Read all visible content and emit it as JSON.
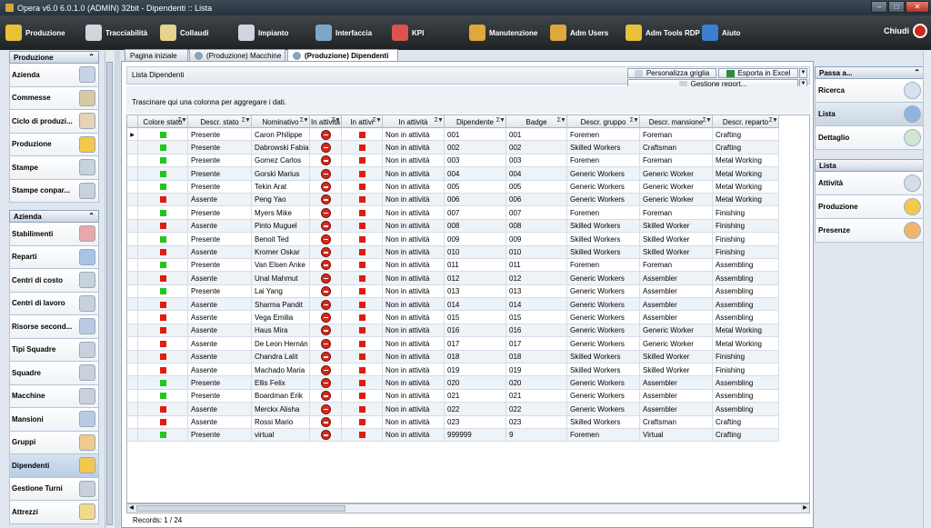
{
  "window": {
    "title": "Opera v6.0 6.0.1.0 (ADMIN) 32bit - Dipendenti :: Lista"
  },
  "menu": {
    "items": [
      {
        "label": "Produzione",
        "icon": "gear-icon",
        "color": "#e8c23a"
      },
      {
        "label": "Tracciabilità",
        "icon": "cable-icon",
        "color": "#cfd6dd"
      },
      {
        "label": "Collaudi",
        "icon": "clipboard-icon",
        "color": "#e7d28e"
      },
      {
        "label": "Impianto",
        "icon": "monitor-icon",
        "color": "#cfd6dd"
      },
      {
        "label": "Interfaccia",
        "icon": "plug-icon",
        "color": "#7fa6c9"
      },
      {
        "label": "KPI",
        "icon": "chart-icon",
        "color": "#d9534f"
      },
      {
        "label": "Manutenzione",
        "icon": "tools-icon",
        "color": "#e0a73a"
      },
      {
        "label": "Adm Users",
        "icon": "user-icon",
        "color": "#e0a73a"
      },
      {
        "label": "Adm Tools RDP",
        "icon": "wrench-icon",
        "color": "#e8c23a"
      },
      {
        "label": "Aiuto",
        "icon": "help-icon",
        "color": "#3a7fd0"
      }
    ],
    "close_label": "Chiudi"
  },
  "leftnav": {
    "produzione_title": "Produzione",
    "produzione_items": [
      "Azienda",
      "Commesse",
      "Ciclo di produzi...",
      "Produzione",
      "Stampe",
      "Stampe conpar..."
    ],
    "azienda_title": "Azienda",
    "azienda_items": [
      "Stabilimenti",
      "Reparti",
      "Centri di costo",
      "Centri di lavoro",
      "Risorse second...",
      "Tipi Squadre",
      "Squadre",
      "Macchine",
      "Mansioni",
      "Gruppi",
      "Dipendenti",
      "Gestione Turni",
      "Attrezzi"
    ],
    "selected": "Dipendenti"
  },
  "tabs": [
    "Pagina iniziale",
    "(Produzione) Macchine",
    "(Produzione) Dipendenti"
  ],
  "list": {
    "title": "Lista Dipendenti",
    "customize_label": "Personalizza griglia",
    "excel_label": "Esporta in Excel",
    "reports_label": "Gestione report...",
    "group_hint": "Trascinare qui una colonna per aggregare i dati.",
    "records_label": "Records: 1 / 24"
  },
  "grid": {
    "columns": [
      "Colore stato",
      "Descr. stato",
      "Nominativo",
      "In attività",
      "In attivi",
      "In attività",
      "Dipendente",
      "Badge",
      "Descr. gruppo",
      "Descr. mansione",
      "Descr. reparto"
    ],
    "status_colors": {
      "green": "#22c51e",
      "red": "#e01b10"
    },
    "rows": [
      {
        "color": "green",
        "stato": "Presente",
        "nome": "Caron Philippe",
        "attivita": "Non in attività",
        "dip": "001",
        "badge": "001",
        "gruppo": "Foremen",
        "mansione": "Foreman",
        "reparto": "Crafting"
      },
      {
        "color": "green",
        "stato": "Presente",
        "nome": "Dabrowski Fabian",
        "attivita": "Non in attività",
        "dip": "002",
        "badge": "002",
        "gruppo": "Skilled Workers",
        "mansione": "Craftsman",
        "reparto": "Crafting"
      },
      {
        "color": "green",
        "stato": "Presente",
        "nome": "Gomez Carlos",
        "attivita": "Non in attività",
        "dip": "003",
        "badge": "003",
        "gruppo": "Foremen",
        "mansione": "Foreman",
        "reparto": "Metal Working"
      },
      {
        "color": "green",
        "stato": "Presente",
        "nome": "Gorski Marius",
        "attivita": "Non in attività",
        "dip": "004",
        "badge": "004",
        "gruppo": "Generic Workers",
        "mansione": "Generic Worker",
        "reparto": "Metal Working"
      },
      {
        "color": "green",
        "stato": "Presente",
        "nome": "Tekin Arat",
        "attivita": "Non in attività",
        "dip": "005",
        "badge": "005",
        "gruppo": "Generic Workers",
        "mansione": "Generic Worker",
        "reparto": "Metal Working"
      },
      {
        "color": "red",
        "stato": "Assente",
        "nome": "Peng Yao",
        "attivita": "Non in attività",
        "dip": "006",
        "badge": "006",
        "gruppo": "Generic Workers",
        "mansione": "Generic Worker",
        "reparto": "Metal Working"
      },
      {
        "color": "green",
        "stato": "Presente",
        "nome": "Myers Mike",
        "attivita": "Non in attività",
        "dip": "007",
        "badge": "007",
        "gruppo": "Foremen",
        "mansione": "Foreman",
        "reparto": "Finishing"
      },
      {
        "color": "red",
        "stato": "Assente",
        "nome": "Pinto Muguel",
        "attivita": "Non in attività",
        "dip": "008",
        "badge": "008",
        "gruppo": "Skilled Workers",
        "mansione": "Skilled Worker",
        "reparto": "Finishing"
      },
      {
        "color": "green",
        "stato": "Presente",
        "nome": "Benoit Ted",
        "attivita": "Non in attività",
        "dip": "009",
        "badge": "009",
        "gruppo": "Skilled Workers",
        "mansione": "Skilled Worker",
        "reparto": "Finishing"
      },
      {
        "color": "red",
        "stato": "Assente",
        "nome": "Kromer Oskar",
        "attivita": "Non in attività",
        "dip": "010",
        "badge": "010",
        "gruppo": "Skilled Workers",
        "mansione": "Skilled Worker",
        "reparto": "Finishing"
      },
      {
        "color": "green",
        "stato": "Presente",
        "nome": "Van Elsen Anke",
        "attivita": "Non in attività",
        "dip": "011",
        "badge": "011",
        "gruppo": "Foremen",
        "mansione": "Foreman",
        "reparto": "Assembling"
      },
      {
        "color": "red",
        "stato": "Assente",
        "nome": "Unal Mahmut",
        "attivita": "Non in attività",
        "dip": "012",
        "badge": "012",
        "gruppo": "Generic Workers",
        "mansione": "Assembler",
        "reparto": "Assembling"
      },
      {
        "color": "green",
        "stato": "Presente",
        "nome": "Lai Yang",
        "attivita": "Non in attività",
        "dip": "013",
        "badge": "013",
        "gruppo": "Generic Workers",
        "mansione": "Assembler",
        "reparto": "Assembling"
      },
      {
        "color": "red",
        "stato": "Assente",
        "nome": "Sharma Pandit",
        "attivita": "Non in attività",
        "dip": "014",
        "badge": "014",
        "gruppo": "Generic Workers",
        "mansione": "Assembler",
        "reparto": "Assembling"
      },
      {
        "color": "red",
        "stato": "Assente",
        "nome": "Vega Emilia",
        "attivita": "Non in attività",
        "dip": "015",
        "badge": "015",
        "gruppo": "Generic Workers",
        "mansione": "Assembler",
        "reparto": "Assembling"
      },
      {
        "color": "red",
        "stato": "Assente",
        "nome": "Haus Mira",
        "attivita": "Non in attività",
        "dip": "016",
        "badge": "016",
        "gruppo": "Generic Workers",
        "mansione": "Generic Worker",
        "reparto": "Metal Working"
      },
      {
        "color": "red",
        "stato": "Assente",
        "nome": "De Leon Hernán",
        "attivita": "Non in attività",
        "dip": "017",
        "badge": "017",
        "gruppo": "Generic Workers",
        "mansione": "Generic Worker",
        "reparto": "Metal Working"
      },
      {
        "color": "red",
        "stato": "Assente",
        "nome": "Chandra Lalit",
        "attivita": "Non in attività",
        "dip": "018",
        "badge": "018",
        "gruppo": "Skilled Workers",
        "mansione": "Skilled Worker",
        "reparto": "Finishing"
      },
      {
        "color": "red",
        "stato": "Assente",
        "nome": "Machado Maria",
        "attivita": "Non in attività",
        "dip": "019",
        "badge": "019",
        "gruppo": "Skilled Workers",
        "mansione": "Skilled Worker",
        "reparto": "Finishing"
      },
      {
        "color": "green",
        "stato": "Presente",
        "nome": "Ellis Felix",
        "attivita": "Non in attività",
        "dip": "020",
        "badge": "020",
        "gruppo": "Generic Workers",
        "mansione": "Assembler",
        "reparto": "Assembling"
      },
      {
        "color": "green",
        "stato": "Presente",
        "nome": "Boardman Erik",
        "attivita": "Non in attività",
        "dip": "021",
        "badge": "021",
        "gruppo": "Generic Workers",
        "mansione": "Assembler",
        "reparto": "Assembling"
      },
      {
        "color": "red",
        "stato": "Assente",
        "nome": "Merckx Alisha",
        "attivita": "Non in attività",
        "dip": "022",
        "badge": "022",
        "gruppo": "Generic Workers",
        "mansione": "Assembler",
        "reparto": "Assembling"
      },
      {
        "color": "red",
        "stato": "Assente",
        "nome": "Rossi Mario",
        "attivita": "Non in attività",
        "dip": "023",
        "badge": "023",
        "gruppo": "Skilled Workers",
        "mansione": "Craftsman",
        "reparto": "Crafting"
      },
      {
        "color": "green",
        "stato": "Presente",
        "nome": "virtual",
        "attivita": "Non in attività",
        "dip": "999999",
        "badge": "9",
        "gruppo": "Foremen",
        "mansione": "Virtual",
        "reparto": "Crafting"
      }
    ]
  },
  "rightnav": {
    "passa_title": "Passa a...",
    "passa_items": [
      "Ricerca",
      "Lista",
      "Dettaglio"
    ],
    "lista_title": "Lista",
    "lista_items": [
      "Attività",
      "Produzione",
      "Presenze"
    ]
  }
}
